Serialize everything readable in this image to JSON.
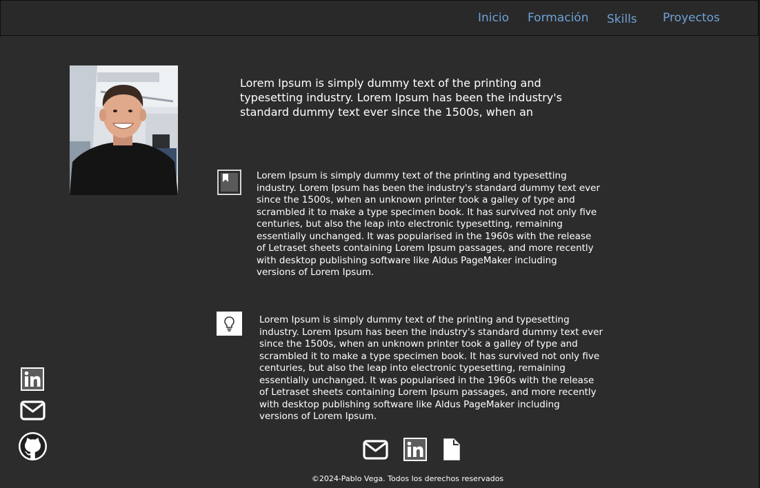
{
  "nav": {
    "items": [
      "Inicio",
      "Formación",
      "Skills",
      "Proyectos"
    ]
  },
  "profile": {
    "photo_alt": "Foto de perfil"
  },
  "intro": {
    "text": "Lorem Ipsum is simply dummy text of the printing and typesetting industry. Lorem Ipsum has been the industry's standard dummy text ever since the 1500s, when an"
  },
  "sections": [
    {
      "icon": "bookmark-icon",
      "text": "Lorem Ipsum is simply dummy text of the printing and  typesetting\nindustry. Lorem Ipsum has been the industry's standard dummy text ever\nsince the 1500s, when an unknown printer took a galley of  type and\nscrambled it to make a type specimen book. It has survived not  only five\ncenturies, but also the leap into electronic typesetting,  remaining\nessentially unchanged. It was popularised in the 1960s with  the release\nof Letraset sheets containing Lorem Ipsum passages, and more recently\nwith desktop publishing software like Aldus PageMaker  including\nversions of Lorem Ipsum."
    },
    {
      "icon": "lightbulb-icon",
      "text": "Lorem Ipsum is simply dummy text of the printing and  typesetting\nindustry. Lorem Ipsum has been the industry's standard dummy text ever\nsince the 1500s, when an unknown printer took a galley of  type and\nscrambled it to make a type specimen book. It has survived not  only five\ncenturies, but also the leap into electronic typesetting,  remaining\nessentially unchanged. It was popularised in the 1960s with  the release\nof Letraset sheets containing Lorem Ipsum passages, and more recently\nwith desktop publishing software like Aldus PageMaker  including\nversions of Lorem Ipsum."
    }
  ],
  "social": [
    "linkedin-icon",
    "envelope-icon",
    "github-icon"
  ],
  "footer": {
    "icons": [
      "envelope-icon",
      "linkedin-icon",
      "document-icon"
    ],
    "text": "©2024-Pablo Vega. Todos los derechos reservados"
  },
  "colors": {
    "background": "#2c2c2c",
    "navbar": "#292929",
    "nav_link": "#6fa2d8",
    "text": "#ffffff"
  }
}
